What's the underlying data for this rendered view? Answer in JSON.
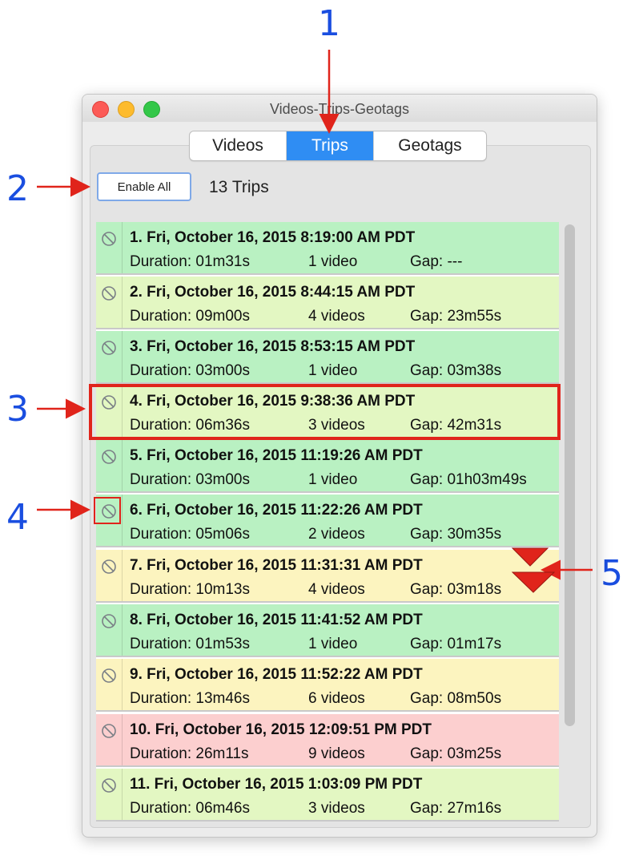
{
  "window": {
    "title": "Videos-Trips-Geotags"
  },
  "tabs": [
    {
      "label": "Videos",
      "active": false
    },
    {
      "label": "Trips",
      "active": true
    },
    {
      "label": "Geotags",
      "active": false
    }
  ],
  "toolbar": {
    "enable_all_label": "Enable All",
    "trip_count": "13 Trips"
  },
  "annotations": [
    "1",
    "2",
    "3",
    "4",
    "5"
  ],
  "colors": {
    "green_row": "#b9f1c2",
    "lightgreen_row": "#e3f7c2",
    "yellow_row": "#fcf4bf",
    "red_row": "#fccfcf",
    "tab_active": "#2f8df3",
    "annotation_blue": "#1a4ee0",
    "annotation_red": "#e0241b"
  },
  "disable_icon": "circle-slash-icon",
  "trips": [
    {
      "title": "1.  Fri, October 16, 2015 8:19:00 AM PDT",
      "duration": "Duration: 01m31s",
      "videos": "1 video",
      "gap": "Gap: ---",
      "color": "#b9f1c2"
    },
    {
      "title": "2.  Fri, October 16, 2015 8:44:15 AM PDT",
      "duration": "Duration: 09m00s",
      "videos": "4 videos",
      "gap": "Gap: 23m55s",
      "color": "#e3f7c2"
    },
    {
      "title": "3.  Fri, October 16, 2015 8:53:15 AM PDT",
      "duration": "Duration: 03m00s",
      "videos": "1 video",
      "gap": "Gap: 03m38s",
      "color": "#b9f1c2"
    },
    {
      "title": "4.  Fri, October 16, 2015 9:38:36 AM PDT",
      "duration": "Duration: 06m36s",
      "videos": "3 videos",
      "gap": "Gap: 42m31s",
      "color": "#e3f7c2"
    },
    {
      "title": "5.  Fri, October 16, 2015 11:19:26 AM PDT",
      "duration": "Duration: 03m00s",
      "videos": "1 video",
      "gap": "Gap: 01h03m49s",
      "color": "#b9f1c2"
    },
    {
      "title": "6.  Fri, October 16, 2015 11:22:26 AM PDT",
      "duration": "Duration: 05m06s",
      "videos": "2 videos",
      "gap": "Gap: 30m35s",
      "color": "#b9f1c2"
    },
    {
      "title": "7.  Fri, October 16, 2015 11:31:31 AM PDT",
      "duration": "Duration: 10m13s",
      "videos": "4 videos",
      "gap": "Gap: 03m18s",
      "color": "#fcf4bf"
    },
    {
      "title": "8.  Fri, October 16, 2015 11:41:52 AM PDT",
      "duration": "Duration: 01m53s",
      "videos": "1 video",
      "gap": "Gap: 01m17s",
      "color": "#b9f1c2"
    },
    {
      "title": "9.  Fri, October 16, 2015 11:52:22 AM PDT",
      "duration": "Duration: 13m46s",
      "videos": "6 videos",
      "gap": "Gap: 08m50s",
      "color": "#fcf4bf"
    },
    {
      "title": "10.  Fri, October 16, 2015 12:09:51 PM PDT",
      "duration": "Duration: 26m11s",
      "videos": "9 videos",
      "gap": "Gap: 03m25s",
      "color": "#fccfcf"
    },
    {
      "title": "11.  Fri, October 16, 2015 1:03:09 PM PDT",
      "duration": "Duration: 06m46s",
      "videos": "3 videos",
      "gap": "Gap: 27m16s",
      "color": "#e3f7c2"
    }
  ]
}
